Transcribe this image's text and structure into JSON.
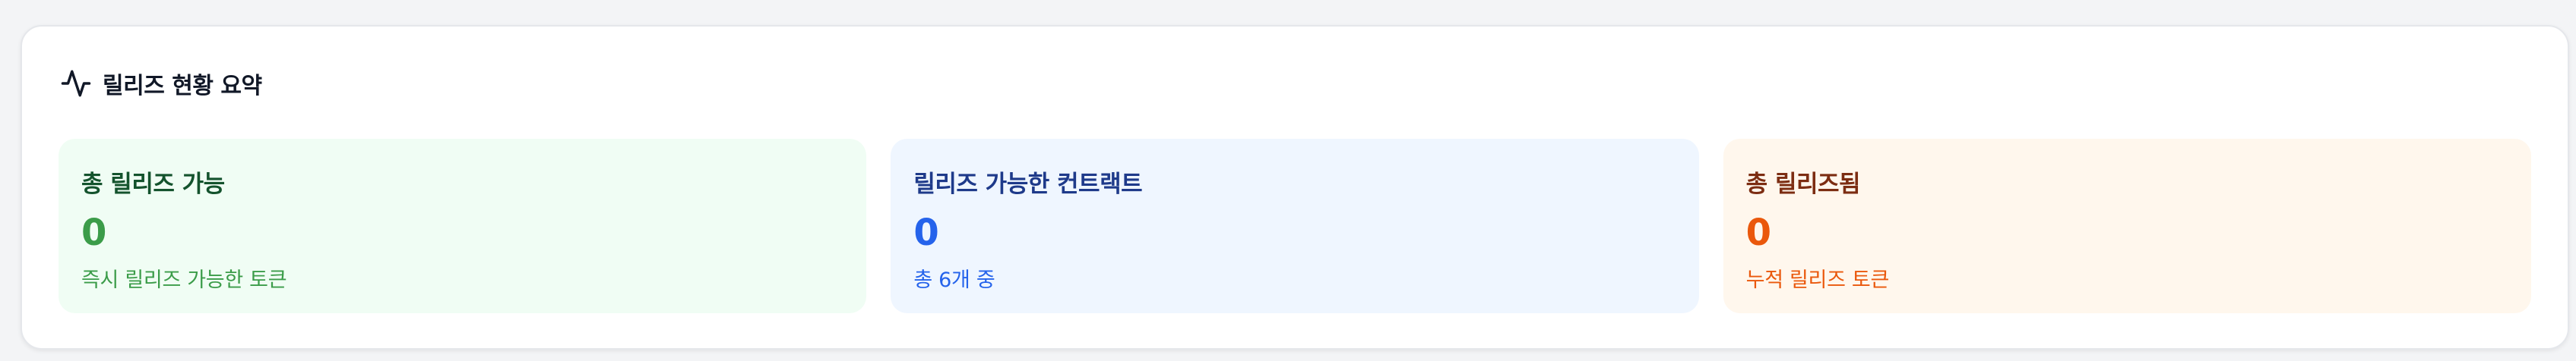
{
  "panel": {
    "title": "릴리즈 현황 요약",
    "icon": "activity-icon"
  },
  "cards": [
    {
      "title": "총 릴리즈 가능",
      "value": "0",
      "subtitle": "즉시 릴리즈 가능한 토큰",
      "accent": "#3b9c49",
      "background": "#f0fdf4"
    },
    {
      "title": "릴리즈 가능한 컨트랙트",
      "value": "0",
      "subtitle": "총 6개 중",
      "accent": "#2563eb",
      "background": "#eff6ff"
    },
    {
      "title": "총 릴리즈됨",
      "value": "0",
      "subtitle": "누적 릴리즈 토큰",
      "accent": "#ea580c",
      "background": "#fff7ed"
    }
  ]
}
